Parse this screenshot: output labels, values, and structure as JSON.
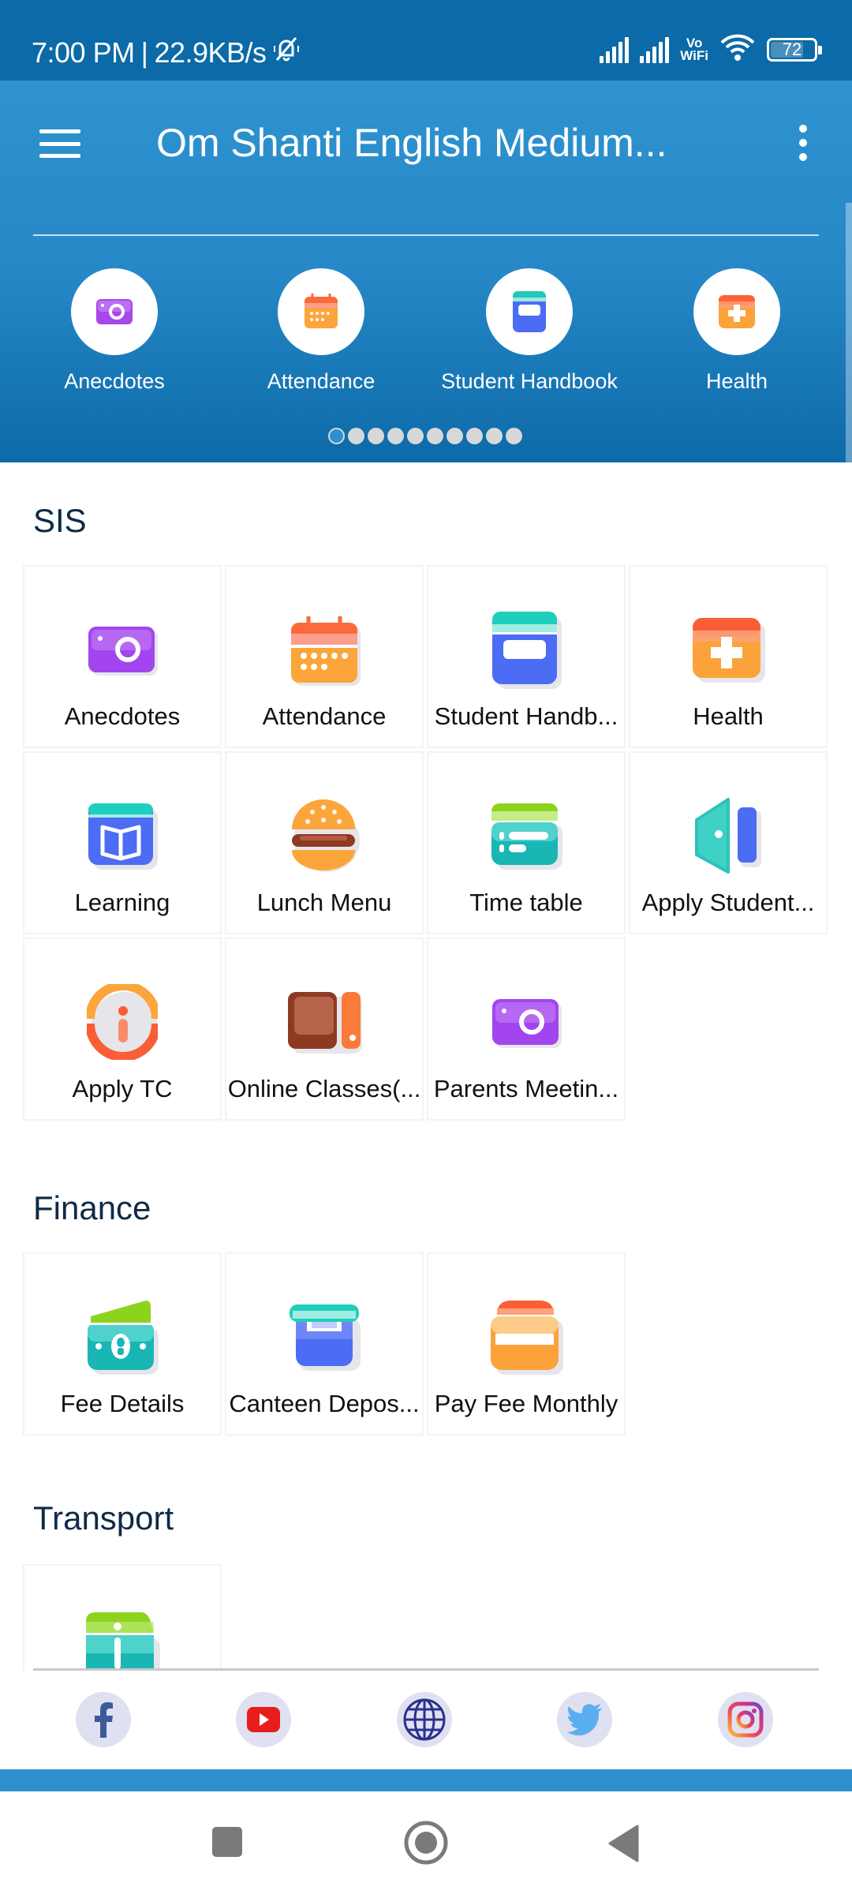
{
  "status_bar": {
    "time": "7:00 PM",
    "separator": "|",
    "network_speed": "22.9KB/s",
    "silent_icon": "bell-off-icon",
    "volte_top": "Vo",
    "volte_bottom": "WiFi",
    "battery_level": "72"
  },
  "app_bar": {
    "menu_icon": "hamburger-menu-icon",
    "title": "Om Shanti English Medium...",
    "more_icon": "more-vertical-icon"
  },
  "quick_access": {
    "items": [
      {
        "label": "Anecdotes",
        "icon": "camera-icon"
      },
      {
        "label": "Attendance",
        "icon": "calendar-icon"
      },
      {
        "label": "Student Handbook",
        "icon": "handbook-icon"
      },
      {
        "label": "Health",
        "icon": "health-kit-icon"
      }
    ],
    "page_count": 10,
    "active_page": 1
  },
  "sections": [
    {
      "title": "SIS",
      "tiles": [
        {
          "label": "Anecdotes",
          "icon": "camera-icon"
        },
        {
          "label": "Attendance",
          "icon": "calendar-icon"
        },
        {
          "label": "Student Handb...",
          "icon": "handbook-icon"
        },
        {
          "label": "Health",
          "icon": "health-kit-icon"
        },
        {
          "label": "Learning",
          "icon": "book-icon"
        },
        {
          "label": "Lunch Menu",
          "icon": "burger-icon"
        },
        {
          "label": "Time table",
          "icon": "timetable-icon"
        },
        {
          "label": "Apply Student...",
          "icon": "door-icon"
        },
        {
          "label": "Apply TC",
          "icon": "info-icon"
        },
        {
          "label": "Online Classes(...",
          "icon": "online-class-icon"
        },
        {
          "label": "Parents Meetin...",
          "icon": "camera-icon"
        }
      ]
    },
    {
      "title": "Finance",
      "tiles": [
        {
          "label": "Fee Details",
          "icon": "wallet-icon"
        },
        {
          "label": "Canteen Depos...",
          "icon": "box-icon"
        },
        {
          "label": "Pay Fee Monthly",
          "icon": "card-icon"
        }
      ]
    },
    {
      "title": "Transport",
      "tiles": [
        {
          "label": "",
          "icon": "bus-info-icon"
        }
      ]
    }
  ],
  "social_links": [
    {
      "name": "facebook",
      "icon": "facebook-icon"
    },
    {
      "name": "youtube",
      "icon": "youtube-icon"
    },
    {
      "name": "website",
      "icon": "globe-icon"
    },
    {
      "name": "twitter",
      "icon": "twitter-icon"
    },
    {
      "name": "instagram",
      "icon": "instagram-icon"
    }
  ],
  "system_nav": {
    "recents": "recents-icon",
    "home": "home-icon",
    "back": "back-icon"
  },
  "colors": {
    "status_bar": "#0b6aa7",
    "banner_top": "#2f93d0",
    "banner_bottom": "#0d6aa8",
    "section_title": "#0e2a47",
    "social_bg": "#dfe1f1",
    "blue_strip": "#2d90cd"
  }
}
